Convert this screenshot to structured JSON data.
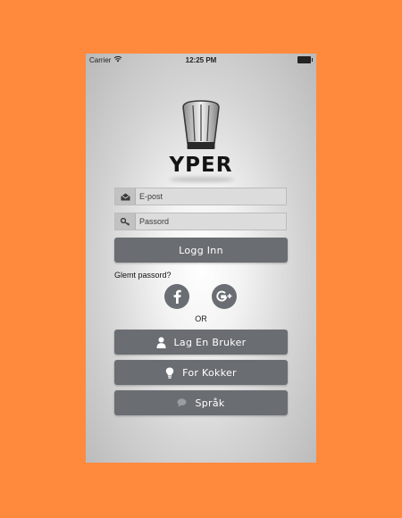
{
  "status_bar": {
    "carrier": "Carrier",
    "time": "12:25 PM"
  },
  "brand": {
    "name": "YPER",
    "logo_icon": "chef-hat-icon"
  },
  "login_form": {
    "email_placeholder": "E-post",
    "email_value": "",
    "email_icon": "envelope-icon",
    "password_placeholder": "Passord",
    "password_value": "",
    "password_icon": "key-icon",
    "login_label": "Logg Inn",
    "forgot_label": "Glemt passord?"
  },
  "social": {
    "facebook_icon": "facebook-icon",
    "google_plus_icon": "google-plus-icon",
    "or_label": "OR"
  },
  "actions": {
    "create_user_label": "Lag En Bruker",
    "create_user_icon": "user-icon",
    "for_chefs_label": "For Kokker",
    "for_chefs_icon": "lightbulb-icon",
    "language_label": "Språk",
    "language_icon": "speech-bubble-icon"
  },
  "colors": {
    "background": "#FF8A3D",
    "button": "#6A6E73",
    "button_text": "#FFFFFF"
  }
}
